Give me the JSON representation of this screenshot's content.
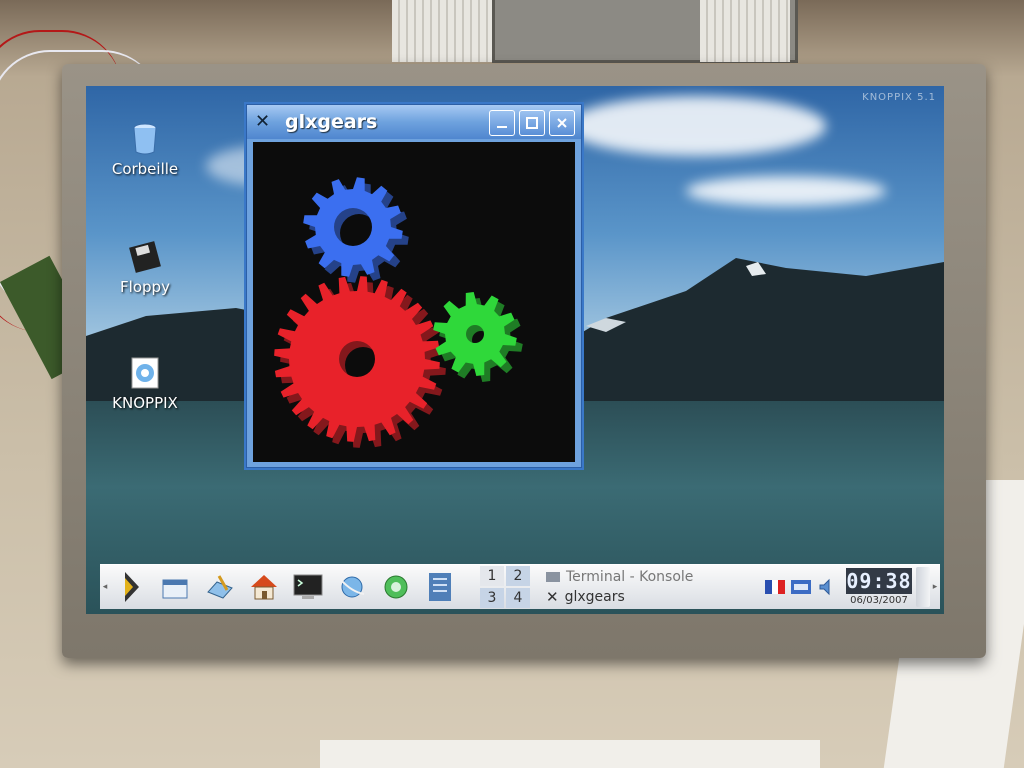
{
  "desktop": {
    "watermark": "KNOPPIX 5.1",
    "icons": [
      {
        "label": "Corbeille",
        "icon": "trash-icon"
      },
      {
        "label": "Floppy",
        "icon": "floppy-icon"
      },
      {
        "label": "KNOPPIX",
        "icon": "knoppix-icon"
      }
    ]
  },
  "window": {
    "title": "glxgears",
    "app_icon": "x-icon",
    "buttons": [
      "minimize-icon",
      "maximize-icon",
      "close-icon"
    ],
    "gears": [
      {
        "color": "#3b6ff0",
        "role": "top-left gear"
      },
      {
        "color": "#e8222a",
        "role": "large gear"
      },
      {
        "color": "#2fd83a",
        "role": "small right gear"
      }
    ]
  },
  "taskbar": {
    "launchers": [
      "kmenu-icon",
      "window-list-icon",
      "editor-icon",
      "home-icon",
      "terminal-icon",
      "browser-icon",
      "network-icon",
      "konqueror-icon"
    ],
    "pager": [
      "1",
      "2",
      "3",
      "4"
    ],
    "active_desktop": "2",
    "tasks": [
      {
        "label": "Terminal - Konsole",
        "active": false
      },
      {
        "label": "glxgears",
        "active": true
      }
    ],
    "tray": [
      "language-flag-icon",
      "keyboard-icon",
      "volume-icon"
    ],
    "clock": {
      "time": "09:38",
      "date": "06/03/2007"
    }
  }
}
